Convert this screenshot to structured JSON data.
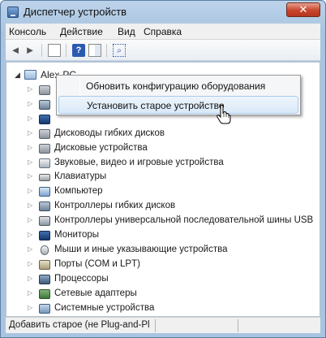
{
  "window": {
    "title": "Диспетчер устройств",
    "close_glyph": "✕"
  },
  "menubar": {
    "items": [
      "Консоль",
      "Действие",
      "Вид",
      "Справка"
    ]
  },
  "toolbar": {
    "back_glyph": "◄",
    "forward_glyph": "►"
  },
  "tree": {
    "root": {
      "label": "Alex-PC",
      "expander": "◢",
      "icon": "computer-icon"
    },
    "expander_glyph": "▷",
    "items": [
      {
        "label": "",
        "icon": "disk-icon"
      },
      {
        "label": "",
        "icon": "device-icon"
      },
      {
        "label": "",
        "icon": "display-adapter-icon"
      },
      {
        "label": "Дисководы гибких дисков",
        "icon": "floppy-icon"
      },
      {
        "label": "Дисковые устройства",
        "icon": "disk-drive-icon"
      },
      {
        "label": "Звуковые, видео и игровые устройства",
        "icon": "sound-icon"
      },
      {
        "label": "Клавиатуры",
        "icon": "keyboard-icon"
      },
      {
        "label": "Компьютер",
        "icon": "computer-icon"
      },
      {
        "label": "Контроллеры гибких дисков",
        "icon": "controller-icon"
      },
      {
        "label": "Контроллеры универсальной последовательной шины USB",
        "icon": "usb-icon"
      },
      {
        "label": "Мониторы",
        "icon": "monitor-icon"
      },
      {
        "label": "Мыши и иные указывающие устройства",
        "icon": "mouse-icon"
      },
      {
        "label": "Порты (COM и LPT)",
        "icon": "port-icon"
      },
      {
        "label": "Процессоры",
        "icon": "cpu-icon"
      },
      {
        "label": "Сетевые адаптеры",
        "icon": "network-icon"
      },
      {
        "label": "Системные устройства",
        "icon": "system-icon"
      }
    ]
  },
  "context_menu": {
    "items": [
      {
        "label": "Обновить конфигурацию оборудования",
        "highlighted": false
      },
      {
        "label": "Установить старое устройство",
        "highlighted": true
      }
    ]
  },
  "statusbar": {
    "message": "Добавить старое (не Plug-and-Pl"
  },
  "colors": {
    "title_gradient": "#a9c4e0",
    "close_button": "#c8452c",
    "menu_highlight": "#d9e9f8",
    "content_bg": "#ffffff"
  }
}
